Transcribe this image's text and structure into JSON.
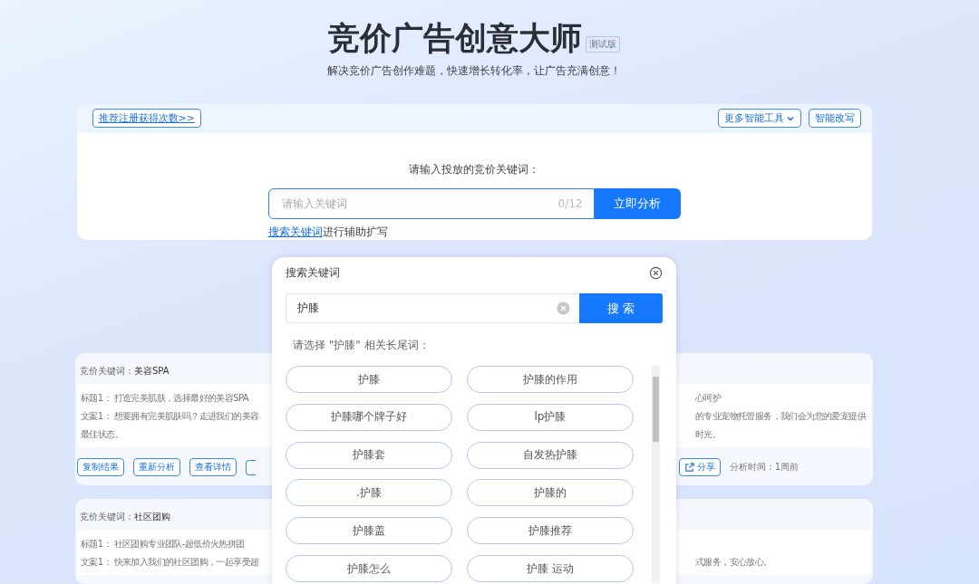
{
  "header": {
    "title": "竞价广告创意大师",
    "badge": "测试版",
    "subtitle": "解决竞价广告创作难题，快速增长转化率，让广告充满创意！"
  },
  "toolbar": {
    "referral_link": "推荐注册获得次数>>",
    "tools_button": "更多智能工具",
    "rewrite_button": "智能改写"
  },
  "analyzer": {
    "label": "请输入投放的竞价关键词：",
    "placeholder": "请输入关键词",
    "counter": "0/12",
    "submit": "立即分析",
    "helper_link": "搜索关键词",
    "helper_text": "进行辅助扩写"
  },
  "results": [
    {
      "keyword_label": "竞价关键词：",
      "keyword": "美容SPA",
      "left_lines": [
        "标题1： 打造完美肌肤，选择最好的美容SPA",
        "文案1： 想要拥有完美肌肤吗？走进我们的美容",
        "最佳状态。"
      ],
      "right_lines": [
        "心呵护",
        "的专业宠物托管服务，我们会为您的爱宠提供",
        "时光。"
      ],
      "actions": [
        "复制结果",
        "重新分析",
        "查看详情"
      ],
      "share": "分享",
      "time": "分析时间：1周前"
    },
    {
      "keyword_label": "竞价关键词：",
      "keyword": "社区团购",
      "left_lines": [
        "标题1： 社区团购专业团队-超低价火热拼团",
        "文案1： 快来加入我们的社区团购，一起享受超"
      ],
      "right_lines": [
        "式服务，安心放心。"
      ]
    }
  ],
  "popup": {
    "title": "搜索关键词",
    "search_value": "护膝",
    "search_button": "搜 索",
    "hint": "请选择 \"护膝\" 相关长尾词：",
    "chips": [
      "护膝",
      "护膝的作用",
      "护膝哪个牌子好",
      "lp护膝",
      "护膝套",
      "自发热护膝",
      ".护膝",
      "护膝的",
      "护膝盖",
      "护膝推荐",
      "护膝怎么",
      "护膝 运动"
    ]
  }
}
